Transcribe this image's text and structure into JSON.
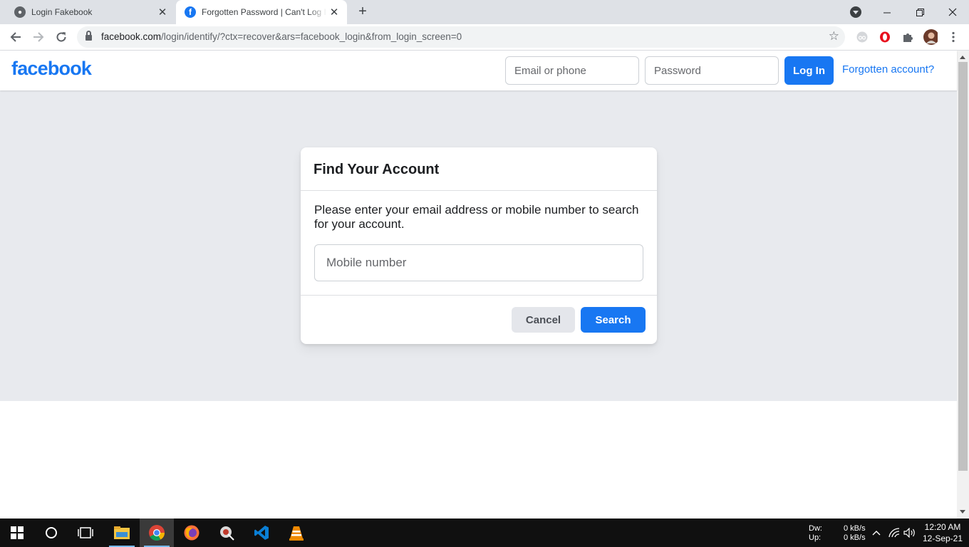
{
  "browser": {
    "tabs": [
      {
        "title": "Login Fakebook",
        "active": false
      },
      {
        "title": "Forgotten Password | Can't Log In",
        "active": true
      }
    ],
    "new_tab_symbol": "+",
    "url_host": "facebook.com",
    "url_path": "/login/identify/?ctx=recover&ars=facebook_login&from_login_screen=0",
    "extensions": [
      "incognito-extension-icon",
      "opera-o-extension-icon",
      "puzzle-extensions-icon",
      "profile-avatar"
    ]
  },
  "header": {
    "logo": "facebook",
    "email_placeholder": "Email or phone",
    "password_placeholder": "Password",
    "login_label": "Log In",
    "forgot_label": "Forgotten account?"
  },
  "card": {
    "title": "Find Your Account",
    "description": "Please enter your email address or mobile number to search for your account.",
    "input_placeholder": "Mobile number",
    "cancel_label": "Cancel",
    "search_label": "Search"
  },
  "taskbar": {
    "net_down_label": "Dw:",
    "net_up_label": "Up:",
    "net_down_value": "0 kB/s",
    "net_up_value": "0 kB/s",
    "time": "12:20 AM",
    "date": "12-Sep-21"
  },
  "colors": {
    "fb_blue": "#1877f2",
    "page_bg": "#e8eaee",
    "tabstrip_bg": "#dee1e6",
    "taskbar_bg": "#101010"
  }
}
